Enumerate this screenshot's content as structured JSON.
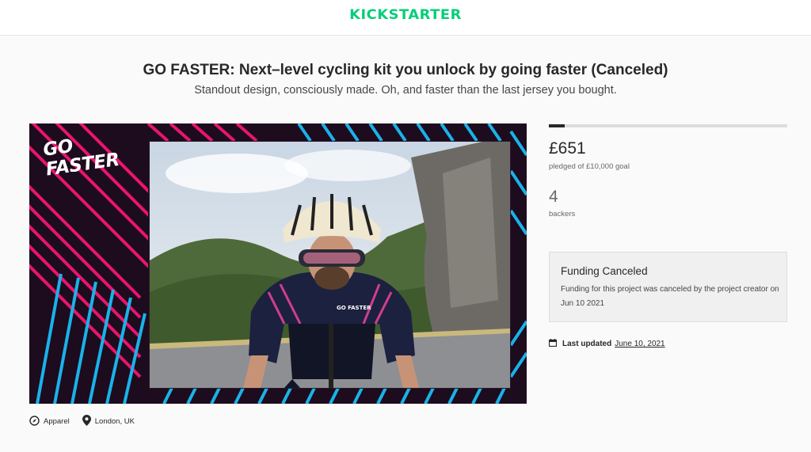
{
  "header": {
    "logo": "KICKSTARTER"
  },
  "project": {
    "title": "GO FASTER: Next–level cycling kit you unlock by going faster (Canceled)",
    "blurb": "Standout design, consciously made. Oh, and faster than the last jersey you bought.",
    "badge_line1": "GO",
    "badge_line2": "FASTER",
    "jersey_text": "GO FASTER",
    "category": "Apparel",
    "location": "London, UK"
  },
  "stats": {
    "pledged": "£651",
    "pledged_label": "pledged of £10,000 goal",
    "progress_fraction": 0.0651,
    "backers": "4",
    "backers_label": "backers"
  },
  "notice": {
    "title": "Funding Canceled",
    "text": "Funding for this project was canceled by the project creator on Jun 10 2021"
  },
  "updated": {
    "label": "Last updated",
    "date": "June 10, 2021"
  },
  "colors": {
    "brand": "#05ce78",
    "frame_pink": "#e8156f",
    "frame_blue": "#1ab2e8",
    "frame_bg": "#1d0b1e"
  },
  "icons": {
    "category": "compass-icon",
    "location": "map-pin-icon",
    "updated": "calendar-icon"
  }
}
